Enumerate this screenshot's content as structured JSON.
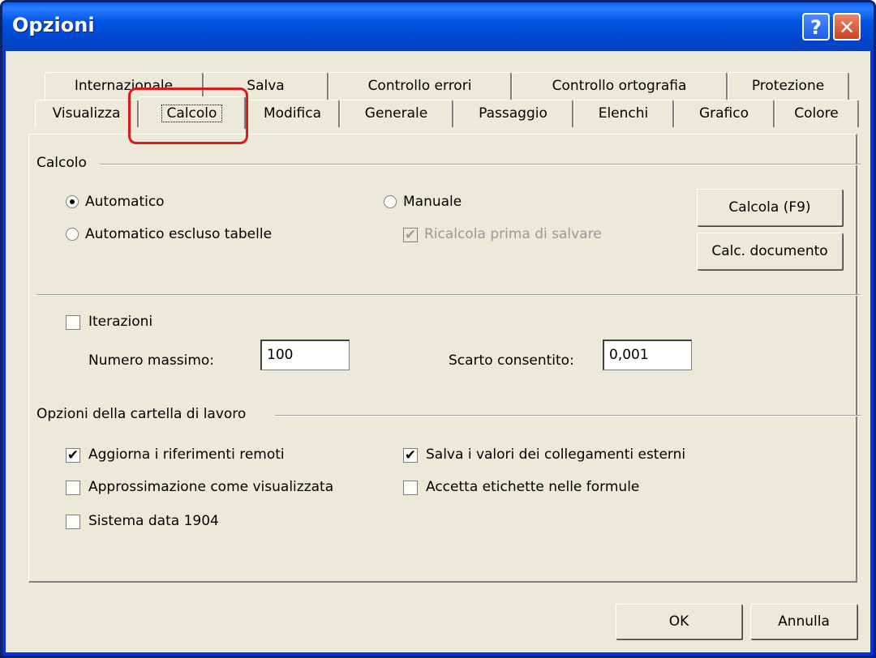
{
  "window": {
    "title": "Opzioni",
    "help_glyph": "?",
    "close_glyph": "✕"
  },
  "tabs": {
    "row_top": [
      "Internazionale",
      "Salva",
      "Controllo errori",
      "Controllo ortografia",
      "Protezione"
    ],
    "row_bottom": [
      "Visualizza",
      "Calcolo",
      "Modifica",
      "Generale",
      "Passaggio",
      "Elenchi",
      "Grafico",
      "Colore"
    ],
    "active": "Calcolo"
  },
  "calcolo": {
    "group_title": "Calcolo",
    "automatico": "Automatico",
    "automatico_escluso": "Automatico escluso tabelle",
    "manuale": "Manuale",
    "ricalcola": "Ricalcola prima di salvare",
    "calcola_button": "Calcola (F9)",
    "calc_doc_button": "Calc. documento",
    "selected": "Automatico"
  },
  "iterazioni": {
    "label": "Iterazioni",
    "checked": false,
    "numero_label": "Numero massimo:",
    "numero_value": "100",
    "scarto_label": "Scarto consentito:",
    "scarto_value": "0,001"
  },
  "workbook": {
    "group_title": "Opzioni della cartella di lavoro",
    "aggiorna": "Aggiorna i riferimenti remoti",
    "approssimazione": "Approssimazione come visualizzata",
    "sistema": "Sistema data 1904",
    "salva_valori": "Salva i valori dei collegamenti esterni",
    "accetta": "Accetta etichette nelle formule",
    "check_mark": "✔"
  },
  "footer": {
    "ok": "OK",
    "annulla": "Annulla"
  },
  "colors": {
    "title_bar": "#0054e3",
    "dialog_bg": "#ece9d8",
    "highlight": "#e01717"
  }
}
